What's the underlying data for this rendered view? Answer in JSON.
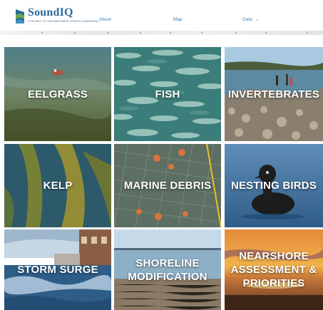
{
  "header": {
    "logo_title": "SoundIQ",
    "logo_subtitle": "A PROJECT OF THE NORTHWEST STRAITS COMMISSION",
    "nav": {
      "about": "About",
      "map": "Map",
      "data": "Data"
    },
    "data_chevron": "⌄"
  },
  "tiles": [
    {
      "label": "EELGRASS"
    },
    {
      "label": "FISH"
    },
    {
      "label": "INVERTEBRATES"
    },
    {
      "label": "KELP"
    },
    {
      "label": "MARINE DEBRIS"
    },
    {
      "label": "NESTING BIRDS"
    },
    {
      "label": "STORM SURGE"
    },
    {
      "label": "SHORELINE\nMODIFICATION"
    },
    {
      "label": "NEARSHORE\nASSESSMENT &\nPRIORITIES"
    }
  ],
  "colors": {
    "brand": "#2e6a9a",
    "nav_link": "#3a7fb5",
    "tile_text": "#ffffff"
  }
}
